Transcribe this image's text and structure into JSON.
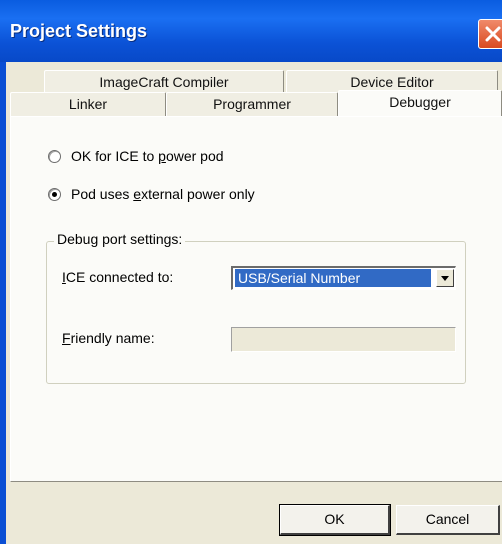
{
  "window": {
    "title": "Project Settings"
  },
  "tabs_row1": [
    {
      "label": "ImageCraft Compiler"
    },
    {
      "label": "Device Editor"
    }
  ],
  "tabs_row2": [
    {
      "label": "Linker"
    },
    {
      "label": "Programmer"
    },
    {
      "label": "Debugger",
      "active": true
    }
  ],
  "power": {
    "option1": {
      "pre": "OK for ICE to ",
      "accel": "p",
      "post": "ower pod",
      "selected": false
    },
    "option2": {
      "pre": "Pod uses ",
      "accel": "e",
      "post": "xternal power only",
      "selected": true
    }
  },
  "debug_port": {
    "legend": "Debug port settings:",
    "ice_label": {
      "accel": "I",
      "post": "CE connected to:"
    },
    "ice_value": "USB/Serial Number",
    "friendly_label": {
      "accel": "F",
      "post": "riendly name:"
    },
    "friendly_value": ""
  },
  "buttons": {
    "ok": "OK",
    "cancel": "Cancel"
  },
  "colors": {
    "titlebar": "#0a5ce0",
    "selection": "#316ac5",
    "face": "#ece9d8",
    "close": "#d94a20"
  }
}
